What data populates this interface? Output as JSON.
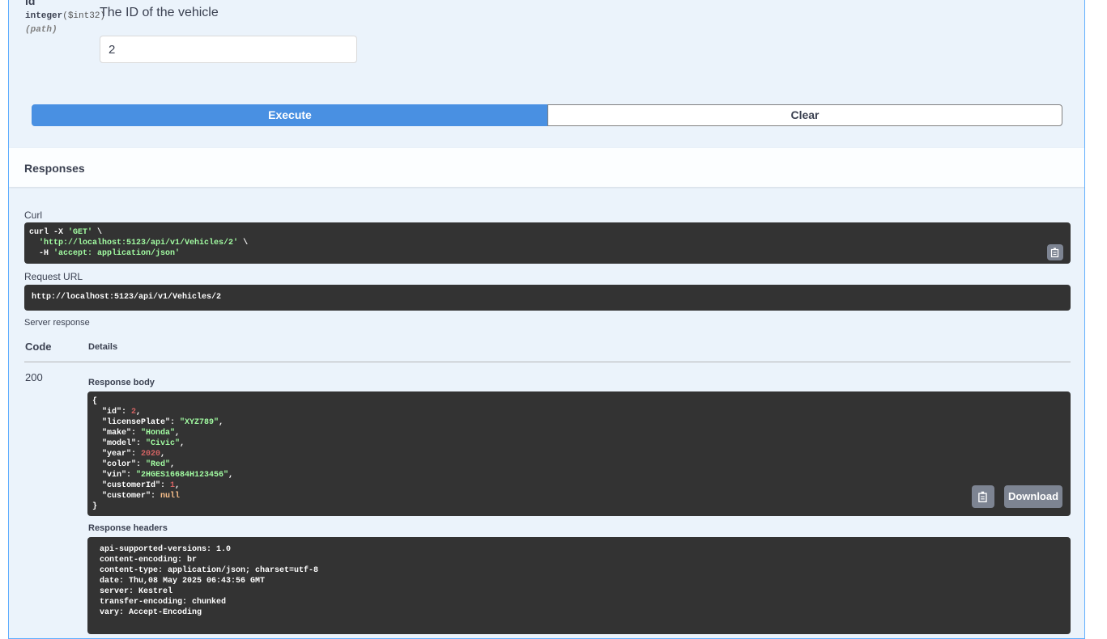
{
  "parameter": {
    "name": "id",
    "required_marker": "*",
    "type": "integer",
    "format": "($int32)",
    "location": "(path)",
    "description": "The ID of the vehicle",
    "value": "2"
  },
  "actions": {
    "execute_label": "Execute",
    "clear_label": "Clear"
  },
  "responses": {
    "title": "Responses",
    "curl_label": "Curl",
    "curl_lines": [
      {
        "pre": "curl -X ",
        "str": "'GET'",
        "post": " \\"
      },
      {
        "pre": "  ",
        "str": "'http://localhost:5123/api/v1/Vehicles/2'",
        "post": " \\"
      },
      {
        "pre": "  -H ",
        "str": "'accept: application/json'",
        "post": ""
      }
    ],
    "request_url_label": "Request URL",
    "request_url": "http://localhost:5123/api/v1/Vehicles/2",
    "server_response_label": "Server response",
    "code_header": "Code",
    "details_header": "Details",
    "status_code": "200",
    "response_body_label": "Response body",
    "response_body": {
      "id": 2,
      "licensePlate": "XYZ789",
      "make": "Honda",
      "model": "Civic",
      "year": 2020,
      "color": "Red",
      "vin": "2HGES16684H123456",
      "customerId": 1,
      "customer": null
    },
    "download_label": "Download",
    "response_headers_label": "Response headers",
    "response_headers": [
      "api-supported-versions: 1.0",
      "content-encoding: br",
      "content-type: application/json; charset=utf-8",
      "date: Thu,08 May 2025 06:43:56 GMT",
      "server: Kestrel",
      "transfer-encoding: chunked",
      "vary: Accept-Encoding"
    ]
  },
  "colors": {
    "execute": "#4990e2",
    "block_bg": "#ebf3fb",
    "code_bg": "#333333",
    "string": "#a2fca2",
    "number": "#d36363",
    "null": "#fcc28c"
  },
  "icons": [
    "copy-icon"
  ]
}
